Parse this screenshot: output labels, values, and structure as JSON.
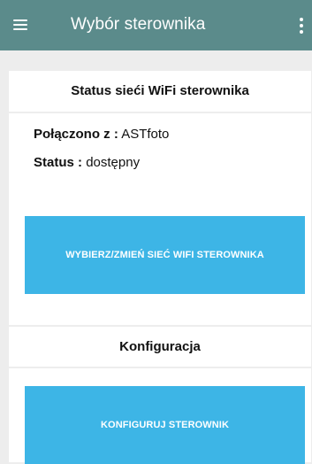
{
  "appbar": {
    "title": "Wybór sterownika",
    "menu_icon": "hamburger-menu-icon",
    "overflow_icon": "more-vert-icon",
    "background": "#5b8b8b"
  },
  "wifi_status": {
    "title": "Status sieći WiFi sterownika",
    "connected_label": "Połączono z :",
    "connected_value": "ASTfoto",
    "status_label": "Status :",
    "status_value": "dostępny"
  },
  "buttons": {
    "change_wifi": "WYBIERZ/ZMIEŃ SIEĆ WIFI STEROWNIKA",
    "configure": "KONFIGURUJ STEROWNIK",
    "color": "#3db5e6"
  },
  "configuration": {
    "title": "Konfiguracja"
  }
}
